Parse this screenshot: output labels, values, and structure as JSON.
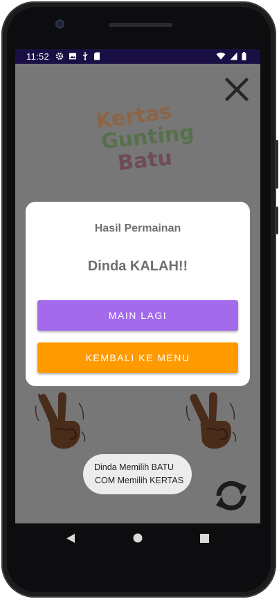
{
  "status_bar": {
    "time": "11:52"
  },
  "logo": {
    "line1": "Kertas",
    "line2": "Gunting",
    "line3": "Batu"
  },
  "dialog": {
    "title": "Hasil Permainan",
    "result": "Dinda KALAH!!",
    "play_again_label": "MAIN LAGI",
    "back_to_menu_label": "KEMBALI KE MENU"
  },
  "toast": {
    "line1": "Dinda Memilih BATU",
    "line2": "COM Memilih KERTAS"
  },
  "colors": {
    "status_bar": "#1a0f44",
    "overlay": "#777777",
    "play_again": "#a36bec",
    "back_to_menu": "#ff9a00"
  },
  "icons": {
    "close": "close-icon",
    "refresh": "refresh-icon",
    "hand_left": "victory-hand-icon",
    "hand_right": "victory-hand-icon"
  }
}
